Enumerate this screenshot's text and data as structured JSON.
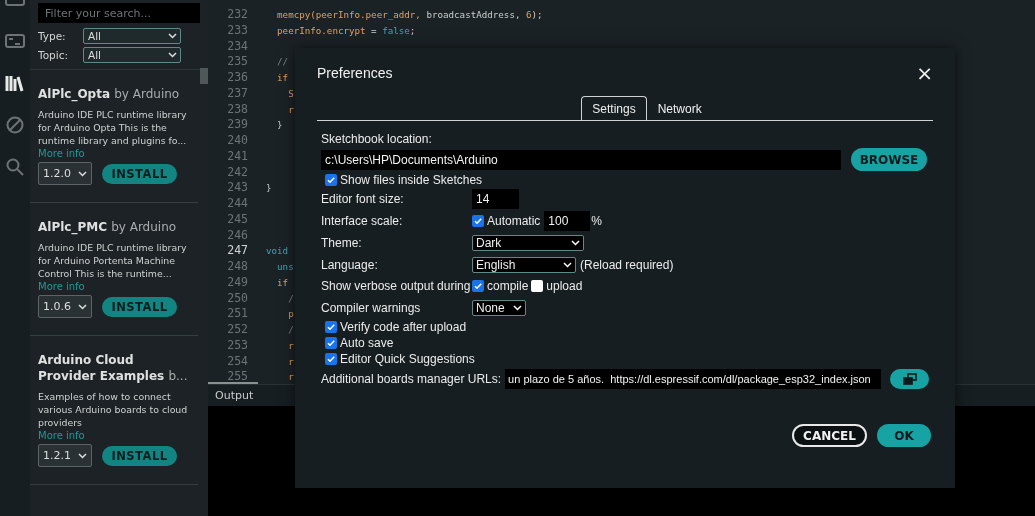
{
  "activity_bar": {
    "items": [
      {
        "kind": "board",
        "selected": false
      },
      {
        "kind": "serial",
        "selected": false
      },
      {
        "kind": "library",
        "selected": true
      },
      {
        "kind": "debug",
        "selected": false
      },
      {
        "kind": "search",
        "selected": false
      }
    ]
  },
  "library_panel": {
    "search": {
      "placeholder": "Filter your search..."
    },
    "filters": [
      {
        "label": "Type:",
        "value": "All"
      },
      {
        "label": "Topic:",
        "value": "All"
      }
    ],
    "items": [
      {
        "name": "AlPlc_Opta",
        "author": "by Arduino",
        "description": "Arduino IDE PLC runtime library for Arduino Opta This is the runtime library and plugins fo...",
        "link": "More info",
        "version": "1.2.0",
        "button": "INSTALL"
      },
      {
        "name": "AlPlc_PMC",
        "author": "by Arduino",
        "description": "Arduino IDE PLC runtime library for Arduino Portenta Machine Control This is the runtime...",
        "link": "More info",
        "version": "1.0.6",
        "button": "INSTALL"
      },
      {
        "name": "Arduino Cloud Provider Examples",
        "author": "b...",
        "description": "Examples of how to connect various Arduino boards to cloud providers",
        "link": "More info",
        "version": "1.2.1",
        "button": "INSTALL"
      }
    ]
  },
  "editor": {
    "lines": [
      {
        "number": "232",
        "current": false,
        "tokens": [
          {
            "text": "  memcpy(peerInfo.peer_addr, ",
            "kind": "name"
          },
          {
            "text": "broadcastAddress, ",
            "kind": "plain"
          },
          {
            "text": "6",
            "kind": "name"
          },
          {
            "text": ");",
            "kind": "plain"
          }
        ]
      },
      {
        "number": "233",
        "current": false,
        "tokens": [
          {
            "text": "  peerInfo.encrypt ",
            "kind": "name"
          },
          {
            "text": "= ",
            "kind": "plain"
          },
          {
            "text": "false",
            "kind": "keyword"
          },
          {
            "text": ";",
            "kind": "plain"
          }
        ]
      },
      {
        "number": "234",
        "current": false
      },
      {
        "number": "235",
        "current": false,
        "tokens": [
          {
            "text": "  //",
            "kind": "comment"
          }
        ]
      },
      {
        "number": "236",
        "current": false,
        "tokens": [
          {
            "text": "  if",
            "kind": "name"
          }
        ]
      },
      {
        "number": "237",
        "current": false,
        "tokens": [
          {
            "text": "    S",
            "kind": "name"
          }
        ]
      },
      {
        "number": "238",
        "current": false,
        "tokens": [
          {
            "text": "    r",
            "kind": "name"
          }
        ]
      },
      {
        "number": "239",
        "current": false,
        "tokens": [
          {
            "text": "  }",
            "kind": "plain"
          }
        ]
      },
      {
        "number": "240",
        "current": false
      },
      {
        "number": "241",
        "current": false
      },
      {
        "number": "242",
        "current": false
      },
      {
        "number": "243",
        "current": false,
        "tokens": [
          {
            "text": "}",
            "kind": "plain"
          }
        ]
      },
      {
        "number": "244",
        "current": false
      },
      {
        "number": "245",
        "current": false
      },
      {
        "number": "246",
        "current": false
      },
      {
        "number": "247",
        "current": true,
        "tokens": [
          {
            "text": "void",
            "kind": "keyword"
          }
        ]
      },
      {
        "number": "248",
        "current": false,
        "tokens": [
          {
            "text": "  uns",
            "kind": "keyword"
          }
        ]
      },
      {
        "number": "249",
        "current": false,
        "tokens": [
          {
            "text": "  if",
            "kind": "name"
          }
        ]
      },
      {
        "number": "250",
        "current": false,
        "tokens": [
          {
            "text": "    /",
            "kind": "comment"
          }
        ]
      },
      {
        "number": "251",
        "current": false,
        "tokens": [
          {
            "text": "    p",
            "kind": "name"
          }
        ]
      },
      {
        "number": "252",
        "current": false,
        "tokens": [
          {
            "text": "    /",
            "kind": "comment"
          }
        ]
      },
      {
        "number": "253",
        "current": false,
        "tokens": [
          {
            "text": "    r",
            "kind": "name"
          }
        ]
      },
      {
        "number": "254",
        "current": false,
        "tokens": [
          {
            "text": "    r",
            "kind": "name"
          }
        ]
      },
      {
        "number": "255",
        "current": false,
        "tokens": [
          {
            "text": "    r",
            "kind": "name"
          }
        ]
      }
    ]
  },
  "output_panel": {
    "tab": "Output"
  },
  "dialog": {
    "title": "Preferences",
    "close": "×",
    "tabs": [
      {
        "label": "Settings",
        "selected": true
      },
      {
        "label": "Network",
        "selected": false
      }
    ],
    "sketchbook": {
      "label": "Sketchbook location:",
      "value": "c:\\Users\\HP\\Documents\\Arduino",
      "button": "BROWSE"
    },
    "show_files": {
      "label": "Show files inside Sketches",
      "checked": true
    },
    "font_size": {
      "label": "Editor font size:",
      "value": "14"
    },
    "interface_scale": {
      "label": "Interface scale:",
      "automatic": {
        "label": "Automatic",
        "checked": true
      },
      "value": "100",
      "unit": "%"
    },
    "theme": {
      "label": "Theme:",
      "value": "Dark"
    },
    "language": {
      "label": "Language:",
      "value": "English",
      "note": "(Reload required)"
    },
    "verbose": {
      "label": "Show verbose output during",
      "options": [
        {
          "label": "compile",
          "checked": true
        },
        {
          "label": "upload",
          "checked": false
        }
      ]
    },
    "compiler_warnings": {
      "label": "Compiler warnings",
      "value": "None"
    },
    "options": [
      {
        "label": "Verify code after upload",
        "checked": true
      },
      {
        "label": "Auto save",
        "checked": true
      },
      {
        "label": "Editor Quick Suggestions",
        "checked": true
      }
    ],
    "board_urls": {
      "label": "Additional boards manager URLs:",
      "value": "un plazo de 5 años.  https://dl.espressif.com/dl/package_esp32_index.json"
    },
    "buttons": [
      {
        "label": "CANCEL",
        "kind": "secondary"
      },
      {
        "label": "OK",
        "kind": "primary"
      }
    ]
  }
}
